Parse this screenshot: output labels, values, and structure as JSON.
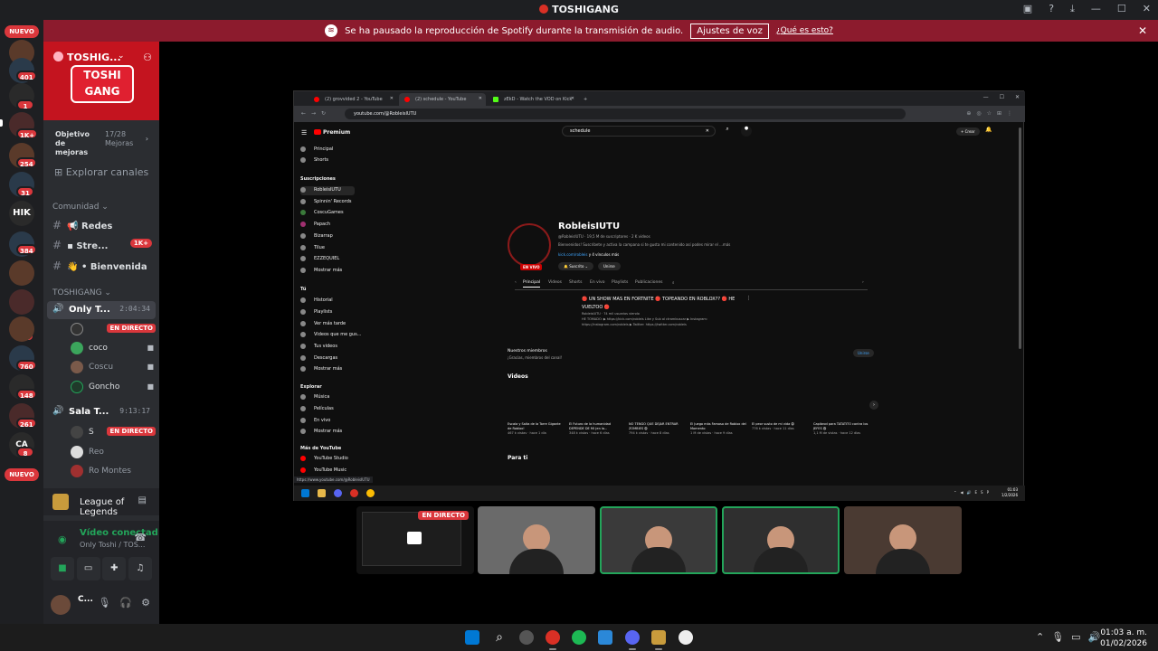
{
  "window": {
    "title": "TOSHIGANG",
    "notice_text": "Se ha pausado la reproducción de Spotify durante la transmisión de audio.",
    "notice_button": "Ajustes de voz",
    "notice_link": "¿Qué es esto?"
  },
  "servers": {
    "nuevo_top": "NUEVO",
    "nuevo_bottom": "NUEVO",
    "badges": [
      "401",
      "1",
      "1K+",
      "254",
      "31",
      "384",
      "20",
      "760",
      "148",
      "261",
      "8"
    ],
    "hik_text": "HIK",
    "ca_text": "CA"
  },
  "server": {
    "name": "TOSHIG...",
    "banner_logo": "TOSHI GANG",
    "goal_label": "Objetivo de mejoras",
    "goal_value": "17/28 Mejoras",
    "explore": "Explorar canales"
  },
  "categories": {
    "comunidad": "Comunidad",
    "toshigang": "TOSHIGANG"
  },
  "channels": [
    {
      "label": "Redes",
      "badge": ""
    },
    {
      "label": "Stre...",
      "badge": "1K+"
    },
    {
      "label": "Bienvenida",
      "badge": ""
    }
  ],
  "voice_channels": [
    {
      "label": "Only T...",
      "time": "2:04:34"
    },
    {
      "label": "Sala T...",
      "time": "9:13:17"
    }
  ],
  "voice_users_1": [
    {
      "name": "",
      "live": "EN DIRECTO"
    },
    {
      "name": "coco",
      "live": ""
    },
    {
      "name": "Coscu",
      "live": ""
    },
    {
      "name": "Goncho",
      "live": ""
    }
  ],
  "voice_users_2": [
    {
      "name": "S",
      "live": "EN DIRECTO"
    },
    {
      "name": "Reo",
      "live": ""
    },
    {
      "name": "Ro Montes",
      "live": ""
    }
  ],
  "activity": {
    "game": "League of Legends"
  },
  "voice_connection": {
    "status": "Vídeo conectad",
    "channel": "Only Toshi / TOS..."
  },
  "user_panel": {
    "name": "C..."
  },
  "browser": {
    "tabs": [
      "(2) grovvided 2 - YouTube",
      "(2) schedule - YouTube",
      "zEkD - Watch the VOD on Kick"
    ],
    "url": "youtube.com/@RobleisIUTU",
    "status_url": "https://www.youtube.com/@RobleisIUTU"
  },
  "youtube": {
    "logo": "Premium",
    "search_value": "schedule",
    "create_label": "+ Crear",
    "sidebar_main": [
      "Principal",
      "Shorts"
    ],
    "subs_header": "Suscripciones",
    "subs": [
      "RobleisIUTU",
      "Spinnin' Records",
      "CoscuGames",
      "Papach",
      "Bizarrap",
      "Tilue",
      "EZZEQUIEL",
      "Mostrar más"
    ],
    "you_header": "Tú",
    "you_items": [
      "Historial",
      "Playlists",
      "Ver más tarde",
      "Videos que me gus...",
      "Tus videos",
      "Descargas",
      "Mostrar más"
    ],
    "explore_header": "Explorar",
    "explore_items": [
      "Música",
      "Películas",
      "En vivo",
      "Mostrar más"
    ],
    "more_header": "Más de YouTube",
    "more_items": [
      "YouTube Studio",
      "YouTube Music"
    ],
    "channel_name": "RobleisIUTU",
    "channel_meta": "@RobleisIUTU · 19,5 M de suscriptores · 2 K videos",
    "channel_desc": "Bienvenidos! Suscribete y activa la campana si te gusta mi contenido así podes mirar el ...más",
    "channel_link": "kick.com/robleis",
    "channel_link_more": "y 4 vínculos más",
    "live_badge": "EN VIVO",
    "subscribed": "Suscrito",
    "join": "Unirse",
    "tabs": [
      "Principal",
      "Videos",
      "Shorts",
      "En vivo",
      "Playlists",
      "Publicaciones"
    ],
    "featured_title": "🔴 UN SHOW MAS EN FORTNITE 🔴 TOPEANDO EN ROBLOX?? 🔴 HE VUELTOO 🔴",
    "featured_meta": "RobleisIUTU · 74 mil usuarios viendo",
    "featured_desc": "HE TOMADO: ▶ https://kick.com/robleis Like y Sub al ctrambuscar ▶ Instagram: https://instagram.com/robleis ▶ Twitter: https://twitter.com/robleis",
    "members_title": "Nuestros miembros",
    "members_sub": "¡Gracias, miembros del canal!",
    "members_join": "Unirse",
    "videos_header": "Videos",
    "videos": [
      {
        "title": "Escala y Salta de la Torre Gigante de Roblox!",
        "meta": "467 k vistas · hace 1 día"
      },
      {
        "title": "El Futuro de la humanidad DEPENDE DE MI (en la...",
        "meta": "348 k vistas · hace 6 días"
      },
      {
        "title": "NO TENGO QUE DEJAR ENTRAR ZOMBIES 😨",
        "meta": "794 k vistas · hace 8 días"
      },
      {
        "title": "El Juego más Famoso de Roblox del Momento",
        "meta": "1 M de vistas · hace 9 días"
      },
      {
        "title": "El peor susto de mi vida 😨",
        "meta": "776 k vistas · hace 11 días"
      },
      {
        "title": "Capibrod para TATATITO contra los JEFES 😨",
        "meta": "1,1 M de vistas · hace 12 días"
      }
    ],
    "for_you": "Para ti"
  },
  "inner_clock": {
    "time": "01:03",
    "date": "1/2/2026",
    "lang": "ESP"
  },
  "stream_tiles": {
    "live_badge": "EN DIRECTO"
  },
  "taskbar": {
    "time": "01:03 a. m.",
    "date": "01/02/2026"
  },
  "colors": {
    "discord_bg": "#2b2d31",
    "notice_red": "#8c1b2d",
    "banner_red": "#c4141f",
    "live_red": "#da373c",
    "speaking_green": "#23a55a"
  }
}
